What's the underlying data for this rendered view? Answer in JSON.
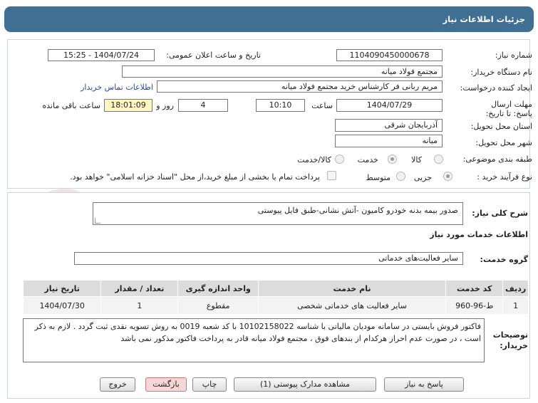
{
  "header": {
    "title": "جزئیات اطلاعات نیاز"
  },
  "need_number": {
    "label": "شماره نیاز:",
    "value": "1104090450000678"
  },
  "announce": {
    "label": "تاریخ و ساعت اعلان عمومی:",
    "value": "1404/07/24 - 15:25"
  },
  "buyer_org": {
    "label": "نام دستگاه خریدار:",
    "value": "مجتمع فولاد میانه"
  },
  "creator": {
    "label": "ایجاد کننده درخواست:",
    "value": "مریم ربانی فر کارشناس خرید مجتمع فولاد میانه",
    "contact_link": "اطلاعات تماس خریدار"
  },
  "deadline": {
    "label": "مهلت ارسال پاسخ: تا تاریخ:",
    "date": "1404/07/29",
    "time_label": "ساعت",
    "time": "10:10",
    "days": "4",
    "days_label": "روز و",
    "remaining": "18:01:09",
    "remaining_label": "ساعت باقی مانده"
  },
  "province": {
    "label": "استان محل تحویل:",
    "value": "آذربایجان شرقی"
  },
  "city": {
    "label": "شهر محل تحویل:",
    "value": "میانه"
  },
  "category": {
    "label": "طبقه بندی موضوعی:",
    "options": [
      "کالا",
      "خدمت",
      "کالا/خدمت"
    ],
    "selected": "خدمت"
  },
  "purchase_process": {
    "label": "نوع فرآیند خرید :",
    "options": [
      "جزیی",
      "متوسط"
    ],
    "selected": "جزیی",
    "payment_note": "پرداخت تمام یا بخشی از مبلغ خرید،از محل \"اسناد خزانه اسلامی\" خواهد بود."
  },
  "summary": {
    "label": "شرح کلی نیاز:",
    "value": "صدور بیمه بدنه خودرو کامیون -آتش نشانی-طبق فایل پیوستی"
  },
  "services_title": "اطلاعات خدمات مورد نیاز",
  "service_group": {
    "label": "گروه خدمت:",
    "value": "سایر فعالیت‌های خدماتی"
  },
  "table": {
    "headers": [
      "ردیف",
      "کد خدمت",
      "نام خدمت",
      "واحد اندازه گیری",
      "تعداد / مقدار",
      "تاریخ نیاز"
    ],
    "rows": [
      [
        "1",
        "ط-96-960",
        "سایر فعالیت های خدماتی شخصی",
        "مقطوع",
        "1",
        "1404/07/30"
      ]
    ]
  },
  "buyer_notes": {
    "label": "توضیحات خریدار:",
    "value": "فاکتور فروش بایستی در سامانه مودیان مالیاتی با شناسه 10102158022 با کد شعبه 0019 به روش تسویه نقدی ثبت گردد . لازم به ذکر است ، در صورت عدم احراز هرکدام از بندهای فوق ، مجتمع فولاد میانه قادر به پرداخت فاکتور مذکور نمی باشد"
  },
  "buttons": {
    "reply": "پاسخ به نیاز",
    "attachments": "مشاهده مدارک پیوستی (1)",
    "print": "چاپ",
    "back": "بازگشت",
    "exit": "خروج"
  },
  "watermark": "AriaTender.net",
  "colors": {
    "header_bg": "#3f6f93",
    "yellow_box": "#fff7bf",
    "link": "#1f4fa8"
  }
}
